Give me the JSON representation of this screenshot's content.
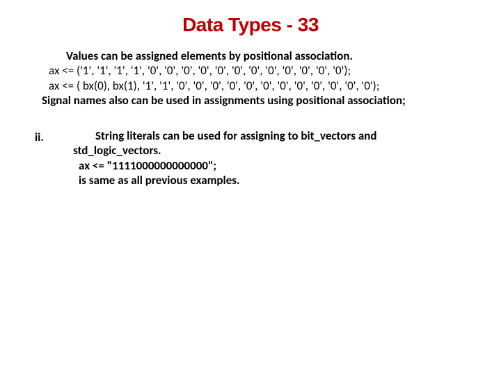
{
  "title": "Data Types - 33",
  "block1": {
    "intro": "Values can be assigned elements by positional association.",
    "code1": "  ax <= ('1', '1', '1', '1', '0', '0', '0', '0', '0', '0', '0', '0', '0', '0', '0', '0');",
    "code2": " ax <= ( bx(0), bx(1), '1', '1', '0', '0', '0', '0', '0', '0', '0', '0', '0', '0', '0', '0');",
    "sig": "Signal names also can be used in assignments using  positional association;"
  },
  "block2": {
    "marker": "ii.",
    "lead": "String literals can be used for assigning to bit_vectors and std_logic_vectors.",
    "code": " ax <= \"1111000000000000\";",
    "same": " is same as all previous examples."
  }
}
